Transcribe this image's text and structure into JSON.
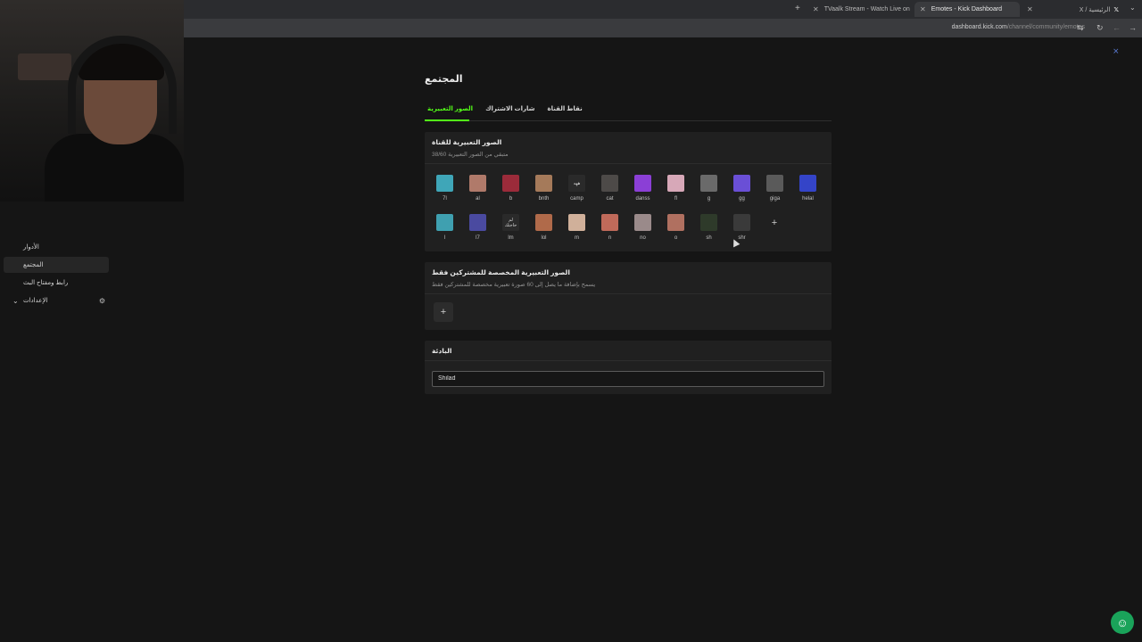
{
  "browser": {
    "tabs": [
      {
        "label": "TVaalk Stream - Watch Live on",
        "active": false
      },
      {
        "label": "Emotes - Kick Dashboard",
        "active": true
      },
      {
        "label": "X / الرئيسية",
        "active": false
      }
    ],
    "url_host": "dashboard.kick.com",
    "url_path": "/channel/community/emotes"
  },
  "sidebar": {
    "items": [
      {
        "label": "الأدوار",
        "active": false
      },
      {
        "label": "المجتمع",
        "active": true
      },
      {
        "label": "رابط ومفتاح البث",
        "active": false
      },
      {
        "label": "الإعدادات",
        "active": false
      }
    ]
  },
  "main": {
    "title": "المجتمع",
    "tabs": [
      {
        "label": "الصور التعبيرية",
        "active": true
      },
      {
        "label": "شارات الاشتراك",
        "active": false
      },
      {
        "label": "نقاط القناة",
        "active": false
      }
    ]
  },
  "channel_emotes": {
    "title": "الصور التعبيرية للقناة",
    "subtitle": "38/60 متبقي من الصور التعبيرية",
    "emotes": [
      {
        "label": "7l",
        "color": "#3fa6b8"
      },
      {
        "label": "al",
        "color": "#b07a6a"
      },
      {
        "label": "b",
        "color": "#9b2b3a"
      },
      {
        "label": "bnth",
        "color": "#a57a5a"
      },
      {
        "label": "camp",
        "color": "#2a2a2a"
      },
      {
        "label": "cat",
        "color": "#4d4a48"
      },
      {
        "label": "danss",
        "color": "#8b3fd6"
      },
      {
        "label": "fl",
        "color": "#d7a8b8"
      },
      {
        "label": "g",
        "color": "#6a6a6a"
      },
      {
        "label": "gg",
        "color": "#6a4fd6"
      },
      {
        "label": "giga",
        "color": "#5a5a5a"
      },
      {
        "label": "helal",
        "color": "#3444c8"
      },
      {
        "label": "l",
        "color": "#3fa0b0"
      },
      {
        "label": "l7",
        "color": "#4a4aa0"
      },
      {
        "label": "lm",
        "color": "#2a2a2a"
      },
      {
        "label": "lol",
        "color": "#b06a4a"
      },
      {
        "label": "m",
        "color": "#d0b09a"
      },
      {
        "label": "n",
        "color": "#c06a5a"
      },
      {
        "label": "no",
        "color": "#9a8a8a"
      },
      {
        "label": "o",
        "color": "#b07060"
      },
      {
        "label": "sh",
        "color": "#2e3a2a"
      },
      {
        "label": "shr",
        "color": "#3a3a3a"
      }
    ],
    "emote_text_overlays": {
      "camp": "ههه",
      "lm": "لم حاجتك"
    },
    "add_label": "+"
  },
  "subscriber_emotes": {
    "title": "الصور التعبيرية المخصصة للمشتركين فقط",
    "subtitle": "يسمح بإضافة ما يصل إلى 60 صورة تعبيرية مخصصة للمشتركين فقط",
    "add_label": "+"
  },
  "prefix": {
    "title": "البادئة",
    "value": "Shilad"
  },
  "icons": {
    "support": "chat-support-icon",
    "collapse": "collapse-sidebar-icon",
    "settings": "gear-icon"
  }
}
